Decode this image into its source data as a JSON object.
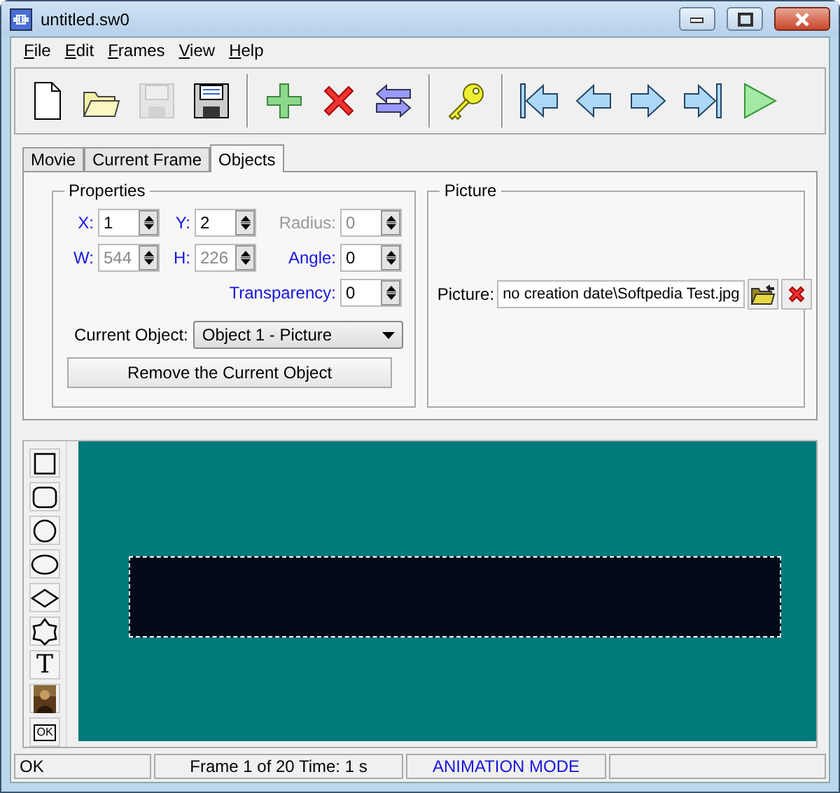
{
  "window": {
    "title": "untitled.sw0"
  },
  "menu": [
    {
      "label": "File"
    },
    {
      "label": "Edit"
    },
    {
      "label": "Frames"
    },
    {
      "label": "View"
    },
    {
      "label": "Help"
    }
  ],
  "toolbar": [
    {
      "kind": "new",
      "disabled": false
    },
    {
      "kind": "open",
      "disabled": false
    },
    {
      "kind": "save",
      "disabled": true
    },
    {
      "kind": "saveas",
      "disabled": false
    },
    {
      "kind": "sep"
    },
    {
      "kind": "add",
      "disabled": false
    },
    {
      "kind": "delete",
      "disabled": false
    },
    {
      "kind": "swap",
      "disabled": false
    },
    {
      "kind": "sep"
    },
    {
      "kind": "key",
      "disabled": false
    },
    {
      "kind": "sep"
    },
    {
      "kind": "first",
      "disabled": false
    },
    {
      "kind": "prev",
      "disabled": false
    },
    {
      "kind": "next",
      "disabled": false
    },
    {
      "kind": "last",
      "disabled": false
    },
    {
      "kind": "play",
      "disabled": false
    }
  ],
  "tabs": [
    {
      "label": "Movie",
      "selected": false
    },
    {
      "label": "Current Frame",
      "selected": false
    },
    {
      "label": "Objects",
      "selected": true
    }
  ],
  "properties": {
    "title": "Properties",
    "fields": [
      {
        "label": "X:",
        "value": "1",
        "label_disabled": false,
        "disabled": false
      },
      {
        "label": "Y:",
        "value": "2",
        "label_disabled": false,
        "disabled": false
      },
      {
        "label": "Radius:",
        "value": "0",
        "label_disabled": true,
        "disabled": true
      },
      {
        "label": "W:",
        "value": "544",
        "label_disabled": false,
        "disabled": true
      },
      {
        "label": "H:",
        "value": "226",
        "label_disabled": false,
        "disabled": true
      },
      {
        "label": "Angle:",
        "value": "0",
        "label_disabled": false,
        "disabled": false
      },
      {
        "label": "Transparency:",
        "value": "0",
        "label_disabled": false,
        "disabled": false
      }
    ],
    "current_object": {
      "label": "Current Object:",
      "value": "Object 1 - Picture"
    },
    "remove_button": "Remove the Current Object"
  },
  "picture": {
    "title": "Picture",
    "label": "Picture:",
    "value": "no creation date\\Softpedia Test.jpg"
  },
  "tools": [
    {
      "kind": "rectangle"
    },
    {
      "kind": "rounded"
    },
    {
      "kind": "circle"
    },
    {
      "kind": "ellipse"
    },
    {
      "kind": "diamond"
    },
    {
      "kind": "star"
    },
    {
      "kind": "text",
      "label": "T"
    },
    {
      "kind": "picture"
    },
    {
      "kind": "button",
      "label": "OK"
    }
  ],
  "canvas": {
    "object": {
      "kind": "picture",
      "selected": true
    }
  },
  "status_bar": [
    {
      "text": "OK",
      "highlight": false
    },
    {
      "text": "Frame 1 of 20 Time: 1 s",
      "highlight": false
    },
    {
      "text": "ANIMATION MODE",
      "highlight": true
    }
  ]
}
